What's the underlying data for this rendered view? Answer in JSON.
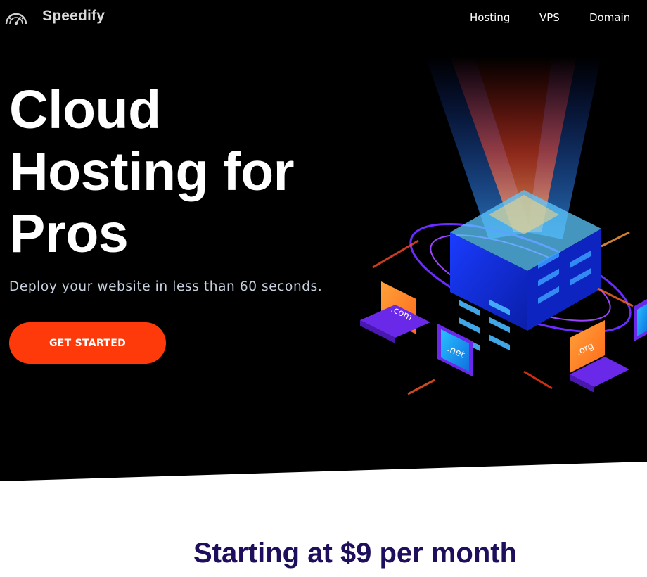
{
  "header": {
    "logo_text": "Speedify",
    "logo_icon": "speedometer-icon",
    "nav": [
      {
        "label": "Hosting"
      },
      {
        "label": "VPS"
      },
      {
        "label": "Domain"
      }
    ]
  },
  "hero": {
    "title_lines": [
      "Cloud",
      "Hosting for",
      "Pros"
    ],
    "subtitle": "Deploy your website in less than 60 seconds.",
    "cta_label": "GET STARTED",
    "illustration": {
      "icon": "server-cloud-illustration",
      "domain_labels": [
        ".com",
        ".net",
        ".org"
      ]
    }
  },
  "pricing": {
    "heading": "Starting at $9 per month"
  },
  "colors": {
    "hero_background": "#000000",
    "cta": "#ff3a0a",
    "heading_dark": "#1e0e5c",
    "subtitle": "#c9d0de"
  }
}
